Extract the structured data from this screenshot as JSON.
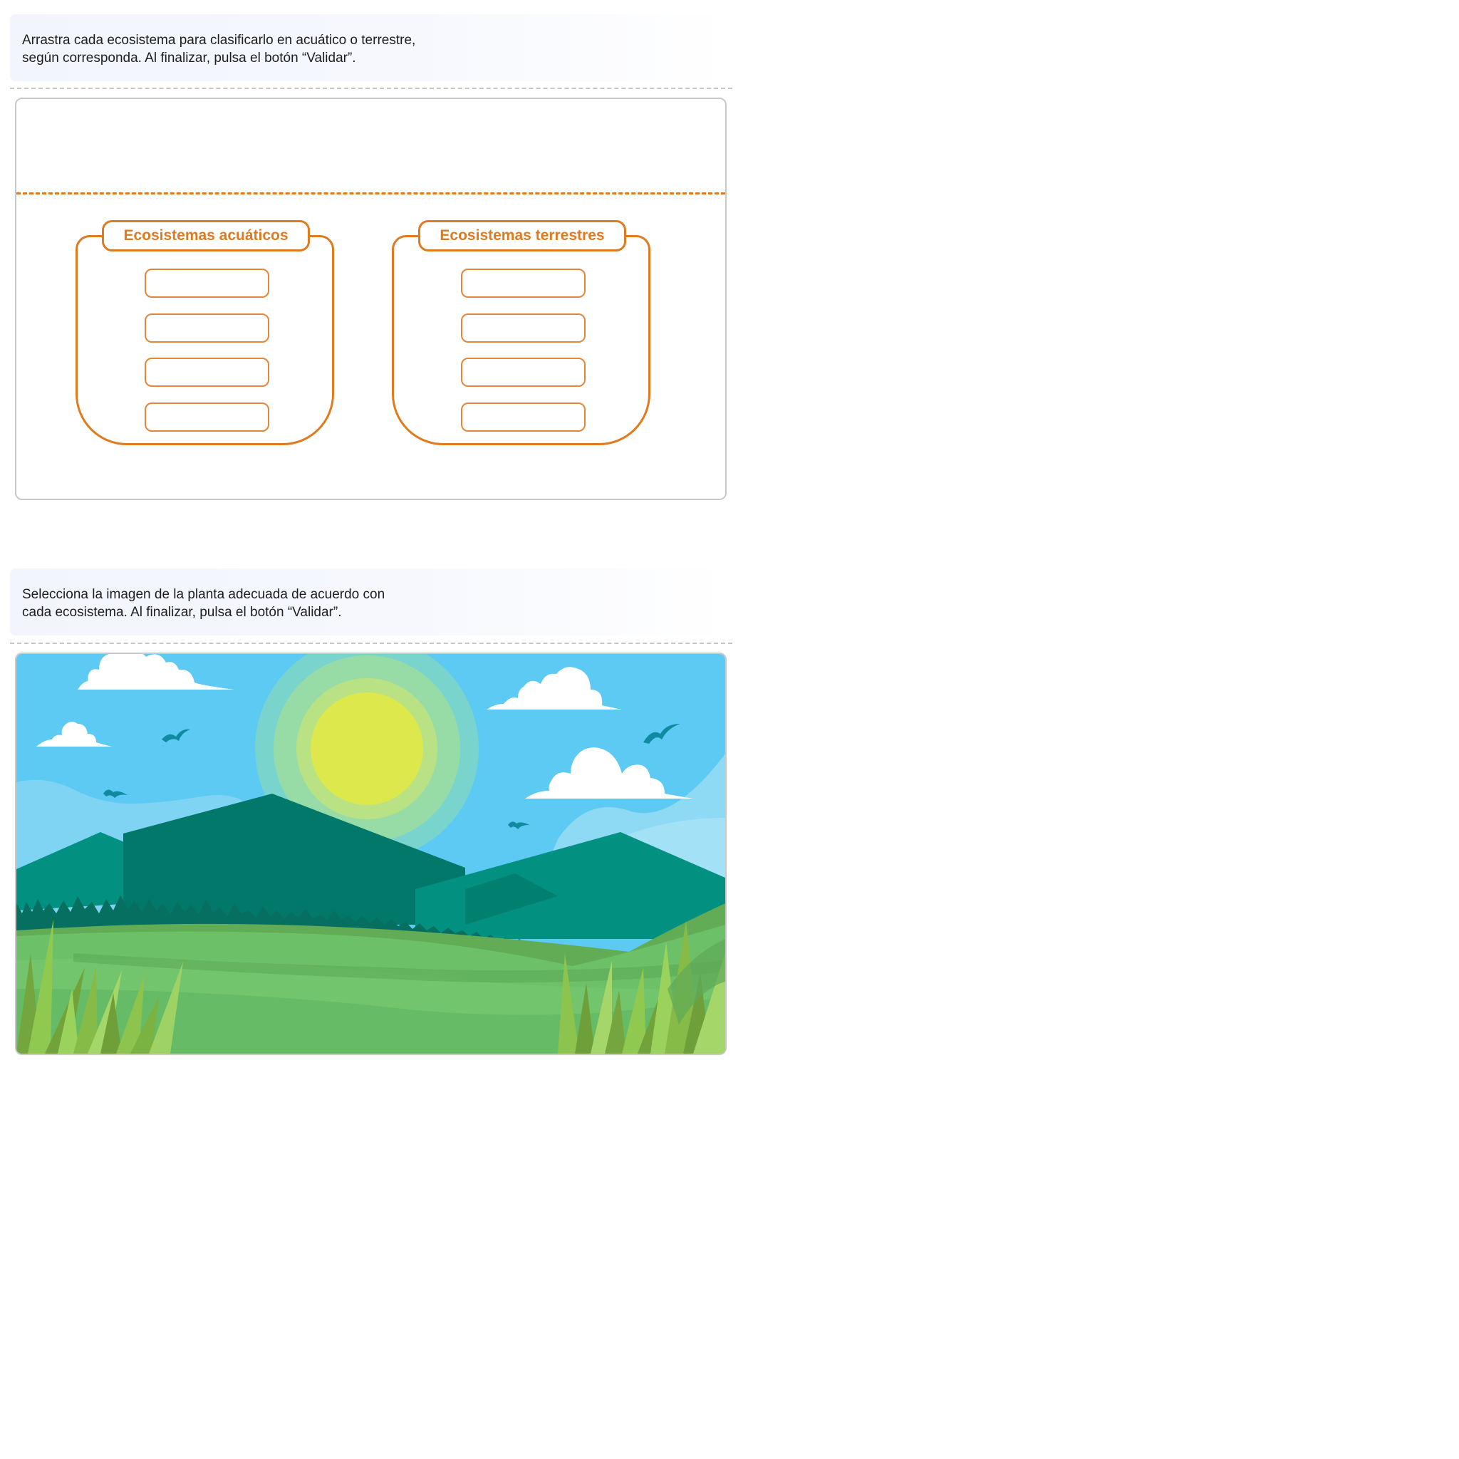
{
  "activity_1": {
    "instruction": {
      "line_1": "Arrastra cada ecosistema para clasificarlo en acuático o terrestre,",
      "line_2": "según corresponda. Al finalizar, pulsa el botón “Validar”."
    },
    "categories": [
      {
        "label": "Ecosistemas acuáticos",
        "slots": 4
      },
      {
        "label": "Ecosistemas terrestres",
        "slots": 4
      }
    ],
    "accent_color": "#e07a1f"
  },
  "activity_2": {
    "instruction": {
      "line_1": "Selecciona la imagen de la planta adecuada de acuerdo con",
      "line_2": "cada ecosistema. Al finalizar, pulsa el botón “Validar”."
    },
    "scene": {
      "elements": [
        "sky",
        "sun",
        "clouds",
        "birds",
        "mountains",
        "forest",
        "meadow",
        "grass"
      ],
      "colors": {
        "sky": "#5ccaf2",
        "sun": "#dde84d",
        "mountain": "#02786b",
        "meadow": "#6cc068"
      }
    }
  }
}
